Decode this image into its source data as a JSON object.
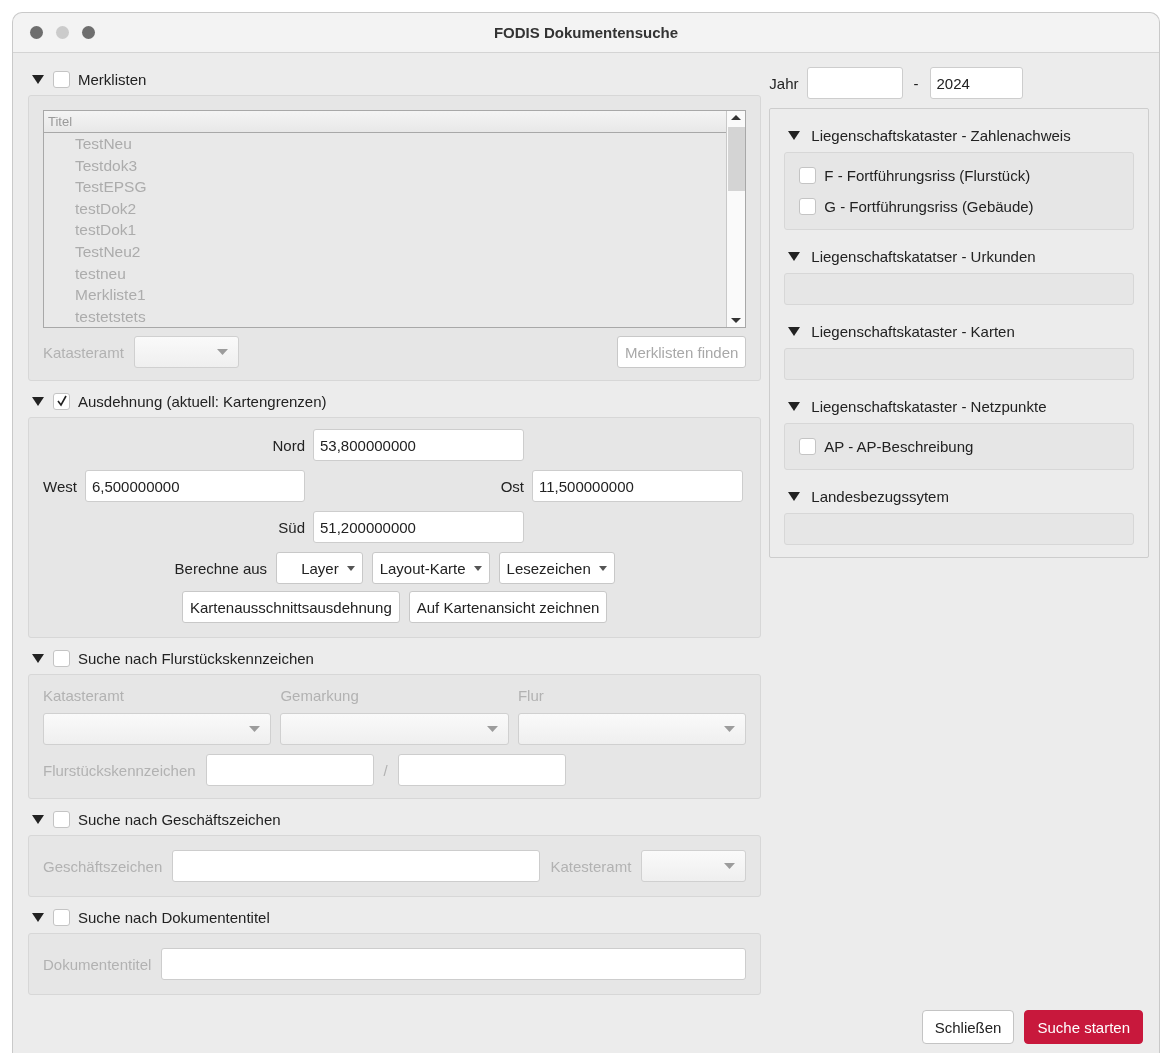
{
  "window": {
    "title": "FODIS Dokumentensuche"
  },
  "sections": [
    {
      "kind": "list",
      "title": "Merklisten",
      "checked": false,
      "expanded": true,
      "column": "Titel",
      "items": [
        "TestNeu",
        "Testdok3",
        "TestEPSG",
        "testDok2",
        "testDok1",
        "TestNeu2",
        "testneu",
        "Merkliste1",
        "testetstets"
      ],
      "filter_label": "Katasteramt",
      "button": "Merklisten finden"
    },
    {
      "kind": "extent",
      "title": "Ausdehnung (aktuell: Kartengrenzen)",
      "checked": true,
      "expanded": true,
      "north": {
        "label": "Nord",
        "value": "53,800000000"
      },
      "west": {
        "label": "West",
        "value": "6,500000000"
      },
      "east": {
        "label": "Ost",
        "value": "11,500000000"
      },
      "south": {
        "label": "Süd",
        "value": "51,200000000"
      },
      "compute_label": "Berechne aus",
      "menus": [
        "Layer",
        "Layout-Karte",
        "Lesezeichen"
      ],
      "buttons": [
        "Kartenausschnittsausdehnung",
        "Auf Kartenansicht zeichnen"
      ]
    },
    {
      "kind": "parcel",
      "title": "Suche nach Flurstückskennzeichen",
      "checked": false,
      "expanded": true,
      "dropdowns": [
        "Katasteramt",
        "Gemarkung",
        "Flur"
      ],
      "parcel_label": "Flurstückskennzeichen",
      "separator": "/"
    },
    {
      "kind": "reference",
      "title": "Suche nach Geschäftszeichen",
      "checked": false,
      "expanded": true,
      "field_label": "Geschäftszeichen",
      "dropdown_label": "Katesteramt"
    },
    {
      "kind": "doctitle",
      "title": "Suche nach Dokumententitel",
      "checked": false,
      "expanded": true,
      "field_label": "Dokumententitel"
    }
  ],
  "year": {
    "label": "Jahr",
    "separator": "-",
    "to": "2024"
  },
  "categories": [
    {
      "title": "Liegenschaftskataster - Zahlenachweis",
      "expanded": true,
      "options": [
        {
          "label": "F - Fortführungsriss (Flurstück)",
          "checked": false
        },
        {
          "label": "G - Fortführungsriss (Gebäude)",
          "checked": false
        }
      ]
    },
    {
      "title": "Liegenschaftskatatser - Urkunden",
      "expanded": true
    },
    {
      "title": "Liegenschaftskataster - Karten",
      "expanded": true
    },
    {
      "title": "Liegenschaftskataster - Netzpunkte",
      "expanded": true,
      "options": [
        {
          "label": "AP - AP-Beschreibung",
          "checked": false
        }
      ]
    },
    {
      "title": "Landesbezugssytem",
      "expanded": true
    }
  ],
  "buttons": [
    {
      "label": "Schließen",
      "kind": "default"
    },
    {
      "label": "Suche starten",
      "kind": "primary"
    }
  ]
}
